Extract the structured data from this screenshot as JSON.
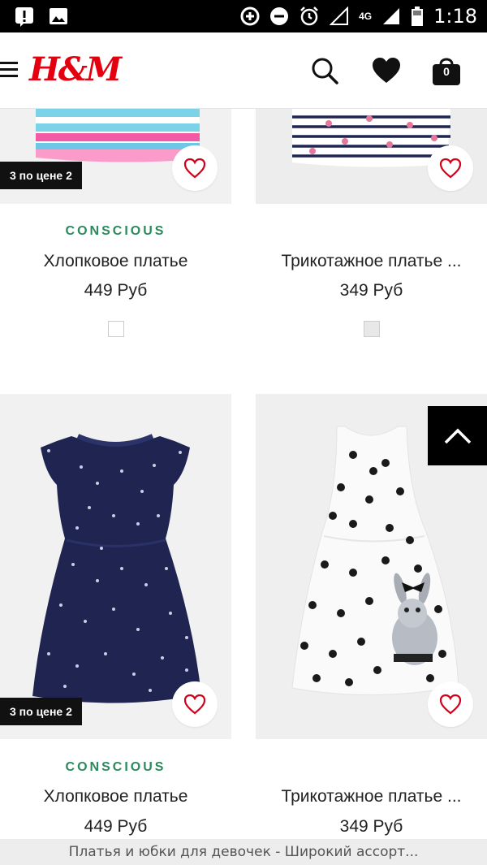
{
  "status_bar": {
    "time": "1:18",
    "network": "4G"
  },
  "header": {
    "logo": "H&M",
    "bag_count": "0"
  },
  "products": [
    {
      "badge": "3 по цене 2",
      "tag": "CONSCIOUS",
      "name": "Хлопковое платье",
      "price": "449 Руб",
      "swatch_color": "#ffffff"
    },
    {
      "badge": "",
      "tag": "",
      "name": "Трикотажное платье ...",
      "price": "349 Руб",
      "swatch_color": "#e8e8e8"
    },
    {
      "badge": "3 по цене 2",
      "tag": "CONSCIOUS",
      "name": "Хлопковое платье",
      "price": "449 Руб"
    },
    {
      "badge": "",
      "tag": "",
      "name": "Трикотажное платье ...",
      "price": "349 Руб"
    }
  ],
  "footer": {
    "text": "Платья и юбки для девочек - Широкий ассорт..."
  },
  "colors": {
    "brand": "#e50010",
    "conscious_green": "#2a8a5c",
    "navy_dress": "#1f2550"
  }
}
